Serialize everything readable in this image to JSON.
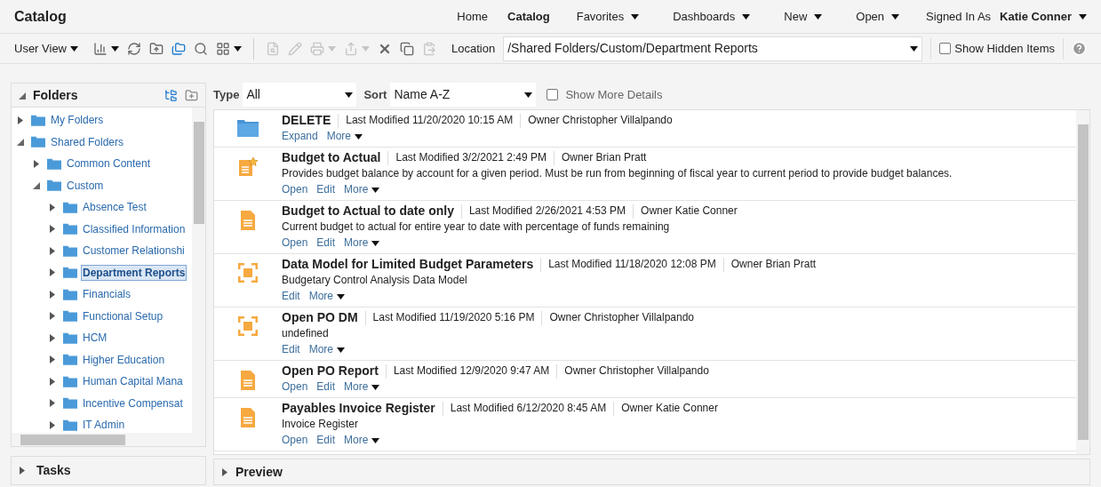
{
  "header": {
    "title": "Catalog",
    "nav": [
      {
        "label": "Home",
        "selected": false,
        "dropdown": false
      },
      {
        "label": "Catalog",
        "selected": true,
        "dropdown": false
      },
      {
        "label": "Favorites",
        "selected": false,
        "dropdown": true
      },
      {
        "label": "Dashboards",
        "selected": false,
        "dropdown": true
      },
      {
        "label": "New",
        "selected": false,
        "dropdown": true
      },
      {
        "label": "Open",
        "selected": false,
        "dropdown": true
      }
    ],
    "signed_in_label": "Signed In As",
    "user": "Katie Conner"
  },
  "toolbar": {
    "view": "User View",
    "tools": [
      {
        "kind": "chart",
        "disabled": false,
        "dropdown": true
      },
      {
        "kind": "refresh",
        "disabled": false,
        "dropdown": false
      },
      {
        "kind": "upload",
        "disabled": false,
        "dropdown": false
      },
      {
        "kind": "folders",
        "disabled": false,
        "dropdown": false
      },
      {
        "kind": "search",
        "disabled": false,
        "dropdown": false
      },
      {
        "kind": "grid",
        "disabled": false,
        "dropdown": true
      },
      {
        "kind": "properties",
        "disabled": true,
        "dropdown": false
      },
      {
        "kind": "edit",
        "disabled": true,
        "dropdown": false
      },
      {
        "kind": "print",
        "disabled": true,
        "dropdown": true
      },
      {
        "kind": "share",
        "disabled": true,
        "dropdown": true
      },
      {
        "kind": "delete",
        "disabled": false,
        "dropdown": false
      },
      {
        "kind": "copy",
        "disabled": false,
        "dropdown": false
      },
      {
        "kind": "paste",
        "disabled": true,
        "dropdown": false
      }
    ],
    "location_label": "Location",
    "location": "/Shared Folders/Custom/Department Reports",
    "show_hidden": {
      "label": "Show Hidden Items",
      "checked": false
    }
  },
  "folders": {
    "title": "Folders",
    "tree": [
      {
        "label": "My Folders",
        "expanded": false,
        "selected": false
      },
      {
        "label": "Shared Folders",
        "expanded": true,
        "selected": false,
        "children": [
          {
            "label": "Common Content",
            "expanded": false,
            "selected": false
          },
          {
            "label": "Custom",
            "expanded": true,
            "selected": false,
            "children": [
              {
                "label": "Absence Test",
                "expanded": false,
                "selected": false
              },
              {
                "label": "Classified Information",
                "expanded": false,
                "selected": false
              },
              {
                "label": "Customer Relationshi",
                "expanded": false,
                "selected": false
              },
              {
                "label": "Department Reports",
                "expanded": false,
                "selected": true
              },
              {
                "label": "Financials",
                "expanded": false,
                "selected": false
              },
              {
                "label": "Functional Setup",
                "expanded": false,
                "selected": false
              },
              {
                "label": "HCM",
                "expanded": false,
                "selected": false
              },
              {
                "label": "Higher Education",
                "expanded": false,
                "selected": false
              },
              {
                "label": "Human Capital Mana",
                "expanded": false,
                "selected": false
              },
              {
                "label": "Incentive Compensat",
                "expanded": false,
                "selected": false
              },
              {
                "label": "IT Admin",
                "expanded": false,
                "selected": false
              }
            ]
          }
        ]
      }
    ]
  },
  "tasks": {
    "title": "Tasks"
  },
  "filters": {
    "type_label": "Type",
    "type": "All",
    "sort_label": "Sort",
    "sort": "Name A-Z",
    "more_details": {
      "label": "Show More Details",
      "checked": false
    }
  },
  "items": [
    {
      "kind": "folder",
      "name": "DELETE",
      "modified": "Last Modified 11/20/2020 10:15 AM",
      "owner": "Owner Christopher Villalpando",
      "actions": [
        "Expand",
        "More"
      ]
    },
    {
      "kind": "favorite_report",
      "name": "Budget to Actual",
      "modified": "Last Modified 3/2/2021 2:49 PM",
      "owner": "Owner Brian Pratt",
      "description": "Provides budget balance by account for a given period. Must be run from beginning of fiscal year to current period to provide budget balances.",
      "actions": [
        "Open",
        "Edit",
        "More"
      ]
    },
    {
      "kind": "report",
      "name": "Budget to Actual to date only",
      "modified": "Last Modified 2/26/2021 4:53 PM",
      "owner": "Owner Katie Conner",
      "description": "Current budget to actual for entire year to date with percentage of funds remaining",
      "actions": [
        "Open",
        "Edit",
        "More"
      ]
    },
    {
      "kind": "data_model",
      "name": "Data Model for Limited Budget Parameters",
      "modified": "Last Modified 11/18/2020 12:08 PM",
      "owner": "Owner Brian Pratt",
      "description": "Budgetary Control Analysis Data Model",
      "actions": [
        "Edit",
        "More"
      ]
    },
    {
      "kind": "data_model",
      "name": "Open PO DM",
      "modified": "Last Modified 11/19/2020 5:16 PM",
      "owner": "Owner Christopher Villalpando",
      "description": "undefined",
      "actions": [
        "Edit",
        "More"
      ]
    },
    {
      "kind": "report",
      "name": "Open PO Report",
      "modified": "Last Modified 12/9/2020 9:47 AM",
      "owner": "Owner Christopher Villalpando",
      "actions": [
        "Open",
        "Edit",
        "More"
      ]
    },
    {
      "kind": "report",
      "name": "Payables Invoice Register",
      "modified": "Last Modified 6/12/2020 8:45 AM",
      "owner": "Owner Katie Conner",
      "description": "Invoice Register",
      "actions": [
        "Open",
        "Edit",
        "More"
      ]
    }
  ],
  "preview": {
    "title": "Preview"
  }
}
